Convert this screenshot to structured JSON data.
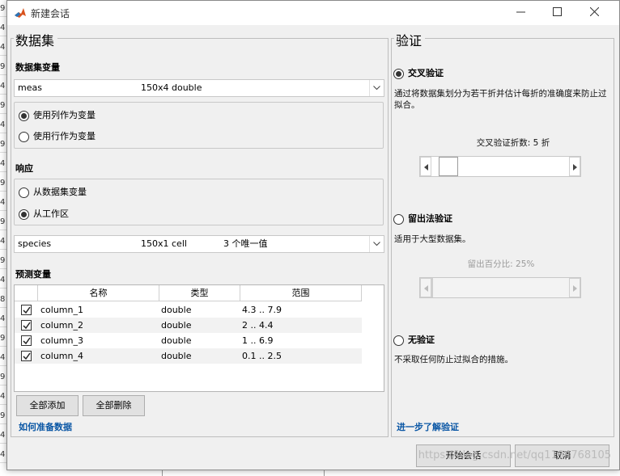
{
  "window": {
    "title": "新建会话",
    "icon": "matlab-logo-icon",
    "controls": {
      "minimize": "—",
      "maximize": "☐",
      "close": "✕"
    }
  },
  "background": {
    "row_snippets": [
      "9",
      "4",
      "4",
      "9",
      "4",
      "9",
      "4",
      "9",
      "4",
      "9",
      "4",
      "9",
      "4",
      "9",
      "4",
      "8",
      "4",
      "9",
      "4",
      "9",
      "4",
      "9",
      "4",
      "4"
    ]
  },
  "dataset": {
    "title": "数据集",
    "variable_label": "数据集变量",
    "variable": {
      "name": "meas",
      "info": "150x4 double"
    },
    "orientation_options": [
      {
        "label": "使用列作为变量",
        "selected": true
      },
      {
        "label": "使用行作为变量",
        "selected": false
      }
    ],
    "response_label": "响应",
    "response_options": [
      {
        "label": "从数据集变量",
        "selected": false
      },
      {
        "label": "从工作区",
        "selected": true
      }
    ],
    "response_var": {
      "name": "species",
      "info": "150x1 cell",
      "extra": "3 个唯一值"
    },
    "predictors_label": "预测变量",
    "table": {
      "headers": [
        "名称",
        "类型",
        "范围"
      ],
      "rows": [
        {
          "checked": true,
          "name": "column_1",
          "type": "double",
          "range": "4.3 .. 7.9"
        },
        {
          "checked": true,
          "name": "column_2",
          "type": "double",
          "range": "2 .. 4.4"
        },
        {
          "checked": true,
          "name": "column_3",
          "type": "double",
          "range": "1 .. 6.9"
        },
        {
          "checked": true,
          "name": "column_4",
          "type": "double",
          "range": "0.1 .. 2.5"
        }
      ]
    },
    "add_all": "全部添加",
    "remove_all": "全部删除",
    "how_to_link": "如何准备数据"
  },
  "validation": {
    "title": "验证",
    "cross": {
      "label": "交叉验证",
      "selected": true,
      "desc": "通过将数据集划分为若干折并估计每折的准确度来防止过拟合。",
      "slider_label": "交叉验证折数: 5 折",
      "folds": 5
    },
    "holdout": {
      "label": "留出法验证",
      "selected": false,
      "desc": "适用于大型数据集。",
      "slider_label": "留出百分比: 25%",
      "percent": 25
    },
    "none": {
      "label": "无验证",
      "selected": false,
      "desc": "不采取任何防止过拟合的措施。"
    },
    "learn_more": "进一步了解验证"
  },
  "footer": {
    "start": "开始会话",
    "cancel": "取消",
    "watermark": "https://blog.csdn.net/qq1194768105"
  },
  "colors": {
    "link": "#0b57a5",
    "dialog_bg": "#f0f0f0"
  }
}
